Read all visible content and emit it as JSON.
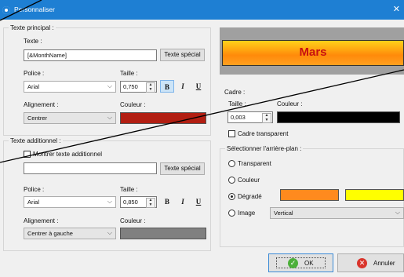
{
  "window": {
    "title": "Personnaliser",
    "icon": "app-icon",
    "close_icon": "close-icon"
  },
  "main_text": {
    "legend": "Texte principal :",
    "text_label": "Texte :",
    "text_value": "[&MonthName]",
    "special_button": "Texte spécial",
    "font_label": "Police :",
    "font_value": "Arial",
    "size_label": "Taille :",
    "size_value": "0,750",
    "bold_label": "B",
    "italic_label": "I",
    "underline_label": "U",
    "align_label": "Alignement :",
    "align_value": "Centrer",
    "color_label": "Couleur :",
    "color": "#b21e12"
  },
  "extra_text": {
    "legend": "Texte additionnel :",
    "show_checkbox": "Montrer texte additionnel",
    "show_checked": false,
    "text_value": "",
    "special_button": "Texte spécial",
    "font_label": "Police :",
    "font_value": "Arial",
    "size_label": "Taille :",
    "size_value": "0,850",
    "bold_label": "B",
    "italic_label": "I",
    "underline_label": "U",
    "align_label": "Alignement :",
    "align_value": "Centrer à gauche",
    "color_label": "Couleur :",
    "color": "#808080"
  },
  "preview": {
    "text": "Mars",
    "text_color": "#c81010"
  },
  "frame": {
    "legend": "Cadre :",
    "size_label": "Taille :",
    "size_value": "0,003",
    "color_label": "Couleur :",
    "color": "#000000",
    "transparent_label": "Cadre transparent",
    "transparent_checked": false
  },
  "background": {
    "legend": "Sélectionner l'arrière-plan :",
    "options": [
      "Transparent",
      "Couleur",
      "Dégradé",
      "Image"
    ],
    "selected": "Dégradé",
    "gradient_color_1": "#ff8a1e",
    "gradient_color_2": "#ffff00",
    "direction_value": "Vertical"
  },
  "buttons": {
    "ok": "OK",
    "cancel": "Annuler"
  }
}
